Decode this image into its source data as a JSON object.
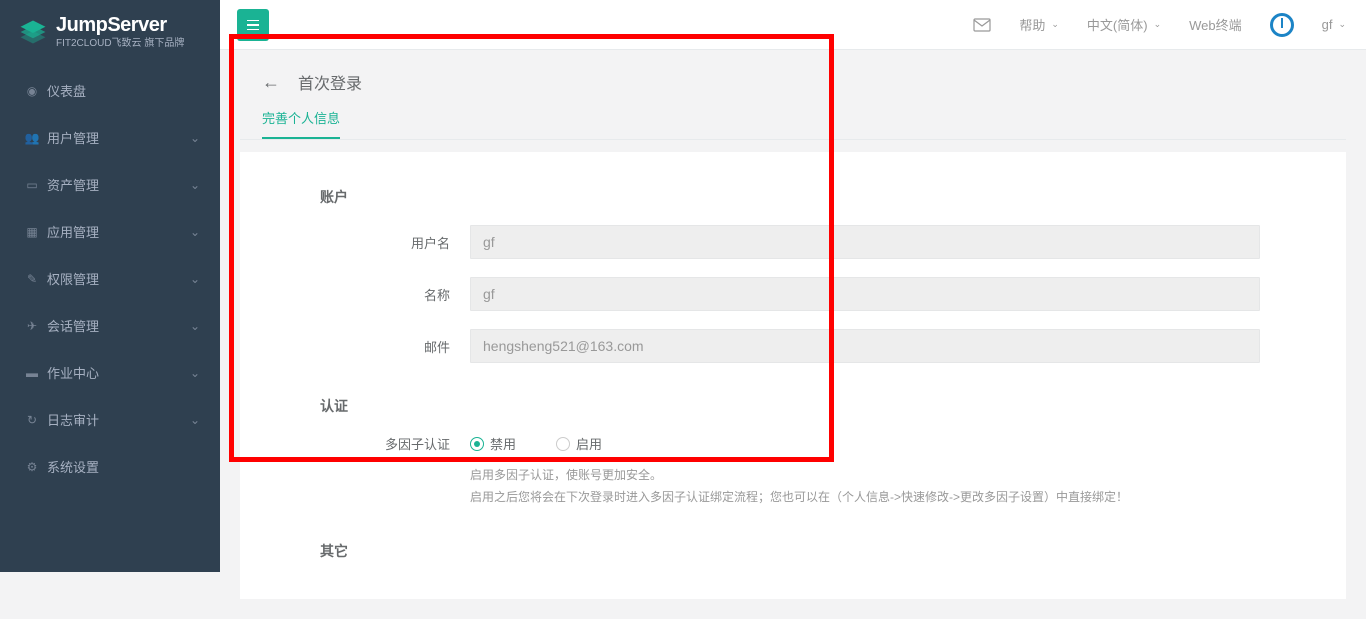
{
  "app": {
    "name": "JumpServer",
    "subtitle": "FIT2CLOUD飞致云 旗下品牌"
  },
  "sidebar": {
    "items": [
      {
        "label": "仪表盘",
        "icon": "dashboard",
        "hasChildren": false
      },
      {
        "label": "用户管理",
        "icon": "users",
        "hasChildren": true
      },
      {
        "label": "资产管理",
        "icon": "laptop",
        "hasChildren": true
      },
      {
        "label": "应用管理",
        "icon": "th",
        "hasChildren": true
      },
      {
        "label": "权限管理",
        "icon": "edit",
        "hasChildren": true
      },
      {
        "label": "会话管理",
        "icon": "rocket",
        "hasChildren": true
      },
      {
        "label": "作业中心",
        "icon": "terminal",
        "hasChildren": true
      },
      {
        "label": "日志审计",
        "icon": "history",
        "hasChildren": true
      },
      {
        "label": "系统设置",
        "icon": "gears",
        "hasChildren": false
      }
    ]
  },
  "topbar": {
    "help": "帮助",
    "language": "中文(简体)",
    "webterminal": "Web终端",
    "username": "gf"
  },
  "page": {
    "title": "首次登录",
    "tab": "完善个人信息"
  },
  "form": {
    "sections": {
      "account": "账户",
      "auth": "认证",
      "other": "其它"
    },
    "fields": {
      "username_label": "用户名",
      "username_value": "gf",
      "name_label": "名称",
      "name_value": "gf",
      "email_label": "邮件",
      "email_value": "hengsheng521@163.com",
      "mfa_label": "多因子认证",
      "mfa_disable": "禁用",
      "mfa_enable": "启用",
      "mfa_help1": "启用多因子认证，使账号更加安全。",
      "mfa_help2": "启用之后您将会在下次登录时进入多因子认证绑定流程；您也可以在（个人信息->快速修改->更改多因子设置）中直接绑定！"
    }
  }
}
